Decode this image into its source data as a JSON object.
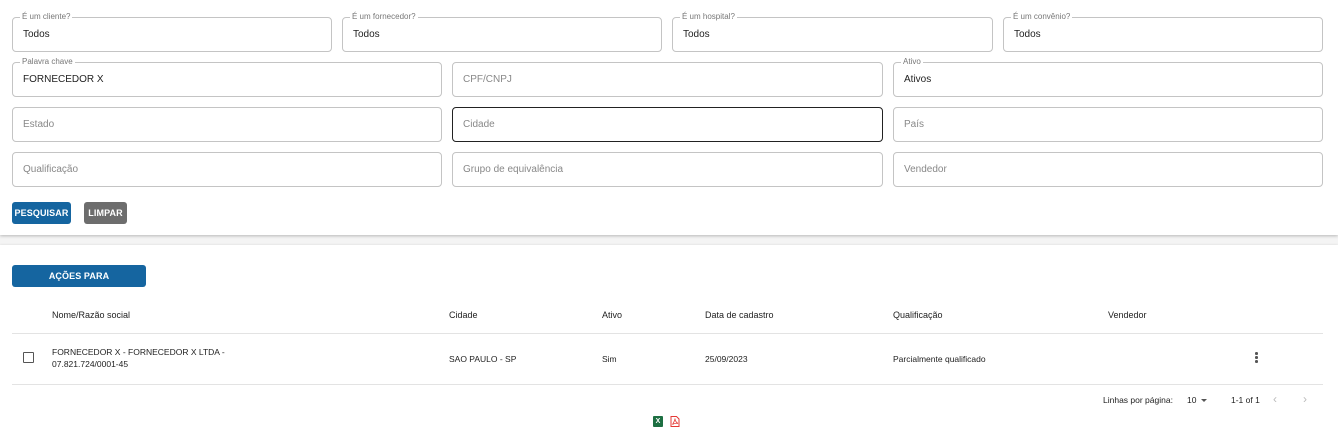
{
  "filters": {
    "cliente": {
      "label": "É um cliente?",
      "value": "Todos"
    },
    "fornecedor": {
      "label": "É um fornecedor?",
      "value": "Todos"
    },
    "hospital": {
      "label": "É um hospital?",
      "value": "Todos"
    },
    "convenio": {
      "label": "É um convênio?",
      "value": "Todos"
    },
    "palavra_chave": {
      "label": "Palavra chave",
      "value": "FORNECEDOR X"
    },
    "cpf_cnpj": {
      "placeholder": "CPF/CNPJ"
    },
    "ativo": {
      "label": "Ativo",
      "value": "Ativos"
    },
    "estado": {
      "placeholder": "Estado"
    },
    "cidade": {
      "placeholder": "Cidade"
    },
    "pais": {
      "placeholder": "País"
    },
    "qualificacao": {
      "placeholder": "Qualificação"
    },
    "grupo": {
      "placeholder": "Grupo de equivalência"
    },
    "vendedor": {
      "placeholder": "Vendedor"
    },
    "search_label": "PESQUISAR",
    "clear_label": "LIMPAR"
  },
  "list": {
    "actions_label": "AÇÕES PARA SELECIONADOS",
    "columns": [
      "Nome/Razão social",
      "Cidade",
      "Ativo",
      "Data de cadastro",
      "Qualificação",
      "Vendedor"
    ],
    "rows": [
      {
        "name_line1": "FORNECEDOR X - FORNECEDOR X LTDA -",
        "name_line2": "07.821.724/0001-45",
        "cidade": "SAO PAULO - SP",
        "ativo": "Sim",
        "data": "25/09/2023",
        "qualificacao": "Parcialmente qualificado",
        "vendedor": ""
      }
    ],
    "pagination": {
      "rows_label": "Linhas por página:",
      "rows_value": "10",
      "range": "1-1 of 1"
    }
  },
  "icons": {
    "excel": "excel-icon",
    "pdf": "pdf-icon",
    "more": "more-vert-icon"
  },
  "colors": {
    "primary": "#1565a0",
    "secondary": "#6d6d6d",
    "excel": "#1d6f42",
    "pdf": "#e53935"
  }
}
